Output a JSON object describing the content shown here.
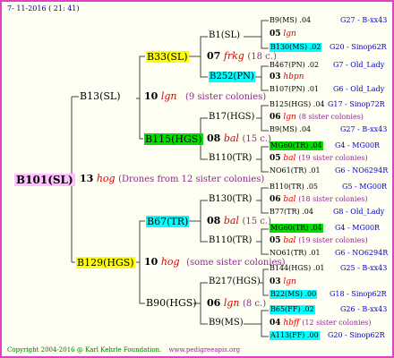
{
  "date": "7- 11-2016 ( 21: 41)",
  "footer": {
    "copyright": "Copyright 2004-2016 @ Karl Kehrle Foundation.",
    "url": "www.pedigreeapis.org"
  },
  "root": {
    "name": "B101(SL)"
  },
  "gen1": {
    "top": {
      "name": "B13(SL)"
    },
    "mid": {
      "num": "13",
      "code": "hog",
      "note": "(Drones from 12 sister colonies)"
    },
    "bot": {
      "name": "B129(HGS)"
    }
  },
  "gen2": {
    "a": {
      "name": "B33(SL)"
    },
    "a_mid": {
      "num": "10",
      "code": "lgn",
      "note": "(9 sister colonies)"
    },
    "b": {
      "name": "B115(HGS)"
    },
    "c": {
      "name": "B67(TR)"
    },
    "c_mid": {
      "num": "10",
      "code": "hog",
      "note": "(some sister colonies)"
    },
    "d": {
      "name": "B90(HGS)"
    }
  },
  "gen3": {
    "a1": {
      "name": "B1(SL)"
    },
    "a_mid": {
      "num": "07",
      "code": "frkg",
      "note": "(18 c.)"
    },
    "a2": {
      "name": "B252(PN)"
    },
    "b1": {
      "name": "B17(HGS)"
    },
    "b_mid": {
      "num": "08",
      "code": "bal",
      "note": "(15 c.)"
    },
    "b2": {
      "name": "B110(TR)"
    },
    "c1": {
      "name": "B130(TR)"
    },
    "c_mid": {
      "num": "08",
      "code": "bal",
      "note": "(15 c.)"
    },
    "c2": {
      "name": "B110(TR)"
    },
    "d1": {
      "name": "B217(HGS)"
    },
    "d_mid": {
      "num": "06",
      "code": "lgn",
      "note": "(8 c.)"
    },
    "d2": {
      "name": "B9(MS)"
    }
  },
  "gen4": [
    {
      "name": "B9(MS) .04",
      "right": "G27 - B-xx43"
    },
    {
      "num": "05",
      "code": "lgn",
      "note": ""
    },
    {
      "name": "B130(MS) .02",
      "right": "G20 - Sinop62R"
    },
    {
      "name": "B467(PN) .02",
      "right": "G7 - Old_Lady"
    },
    {
      "num": "03",
      "code": "hbpn",
      "note": ""
    },
    {
      "name": "B107(PN) .01",
      "right": "G6 - Old_Lady"
    },
    {
      "name": "B125(HGS) .04",
      "right": "G17 - Sinop72R"
    },
    {
      "num": "06",
      "code": "lgn",
      "note": "(8 sister colonies)"
    },
    {
      "name": "B9(MS) .04",
      "right": "G27 - B-xx43"
    },
    {
      "name": "MG60(TR) .04",
      "right": "G4 - MG00R"
    },
    {
      "num": "05",
      "code": "bal",
      "note": "(19 sister colonies)"
    },
    {
      "name": "NO61(TR) .01",
      "right": "G6 - NO6294R"
    },
    {
      "name": "B110(TR) .05",
      "right": "G5 - MG00R"
    },
    {
      "num": "06",
      "code": "bal",
      "note": "(18 sister colonies)"
    },
    {
      "name": "B77(TR) .04",
      "right": "G8 - Old_Lady"
    },
    {
      "name": "MG60(TR) .04",
      "right": "G4 - MG00R"
    },
    {
      "num": "05",
      "code": "bal",
      "note": "(19 sister colonies)"
    },
    {
      "name": "NO61(TR) .01",
      "right": "G6 - NO6294R"
    },
    {
      "name": "B144(HGS) .01",
      "right": "G25 - B-xx43"
    },
    {
      "num": "03",
      "code": "lgn",
      "note": ""
    },
    {
      "name": "B22(MS) .00",
      "right": "G18 - Sinop62R"
    },
    {
      "name": "B65(FF) .02",
      "right": "G26 - B-xx43"
    },
    {
      "num": "04",
      "code": "hbff",
      "note": "(12 sister colonies)"
    },
    {
      "name": "A113(FF) .00",
      "right": "G20 - Sinop62R"
    }
  ]
}
